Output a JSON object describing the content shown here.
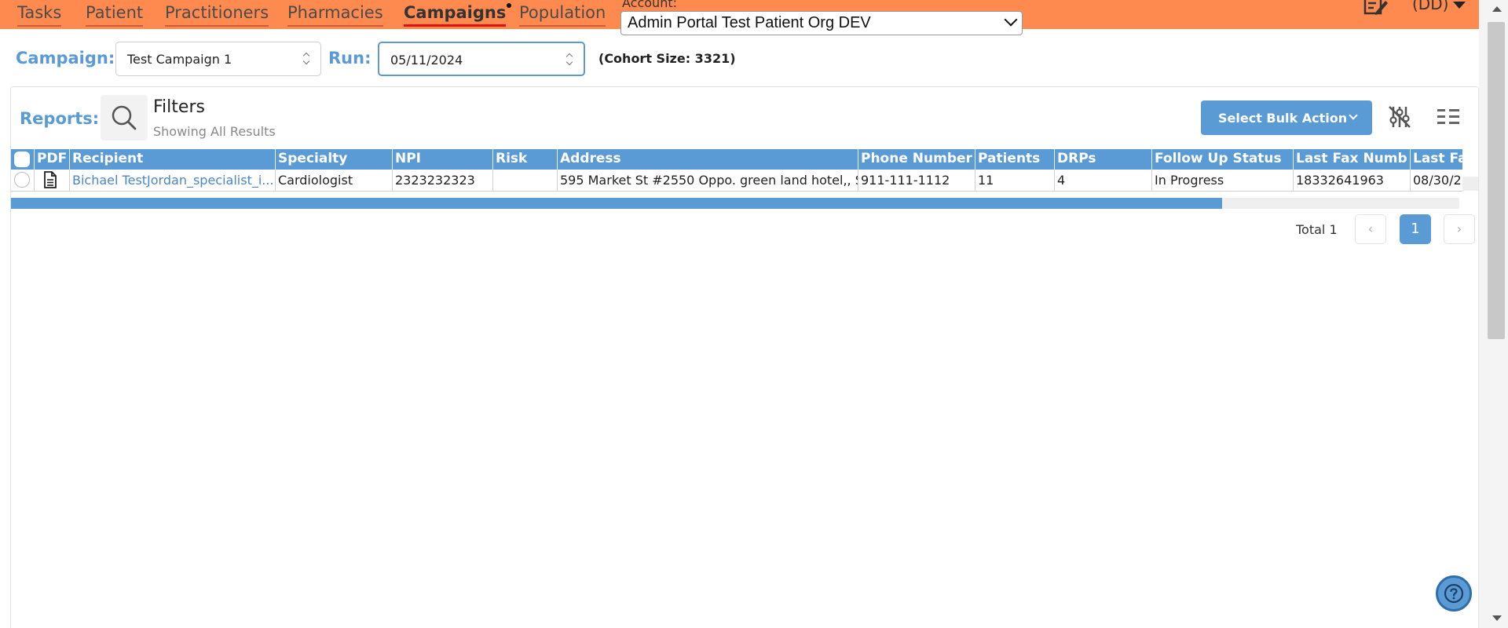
{
  "nav": {
    "items": [
      {
        "label": "Tasks"
      },
      {
        "label": "Patient"
      },
      {
        "label": "Practitioners"
      },
      {
        "label": "Pharmacies"
      },
      {
        "label": "Campaigns",
        "active": true
      },
      {
        "label": "Population"
      }
    ],
    "account_label": "Account:",
    "account_value": "Admin Portal Test Patient Org DEV",
    "user_initials": "(DD)"
  },
  "campaign": {
    "campaign_label": "Campaign:",
    "campaign_value": "Test Campaign 1",
    "run_label": "Run:",
    "run_value": "05/11/2024",
    "cohort_text": "(Cohort Size:  3321)"
  },
  "reports": {
    "label": "Reports:",
    "filters_title": "Filters",
    "filters_subtitle": "Showing All Results",
    "bulk_action_label": "Select Bulk Action"
  },
  "table": {
    "columns": [
      "",
      "PDF",
      "Recipient",
      "Specialty",
      "NPI",
      "Risk",
      "Address",
      "Phone Number",
      "Patients",
      "DRPs",
      "Follow Up Status",
      "Last Fax Numb",
      "Last Fax"
    ],
    "rows": [
      {
        "recipient": "Bichael TestJordan_specialist_i...",
        "specialty": "Cardiologist",
        "npi": "2323232323",
        "risk": "",
        "address": "595 Market St #2550 Oppo. green land hotel,, S",
        "phone": "911-111-1112",
        "patients": "11",
        "drps": "4",
        "follow_up_status": "In Progress",
        "last_fax_number": "18332641963",
        "last_fax": "08/30/2"
      }
    ]
  },
  "pagination": {
    "total_text": "Total 1",
    "current_page": "1",
    "prev": "‹",
    "next": "›"
  },
  "colors": {
    "topbar": "#ff8a50",
    "accent": "#5b9bd5"
  }
}
